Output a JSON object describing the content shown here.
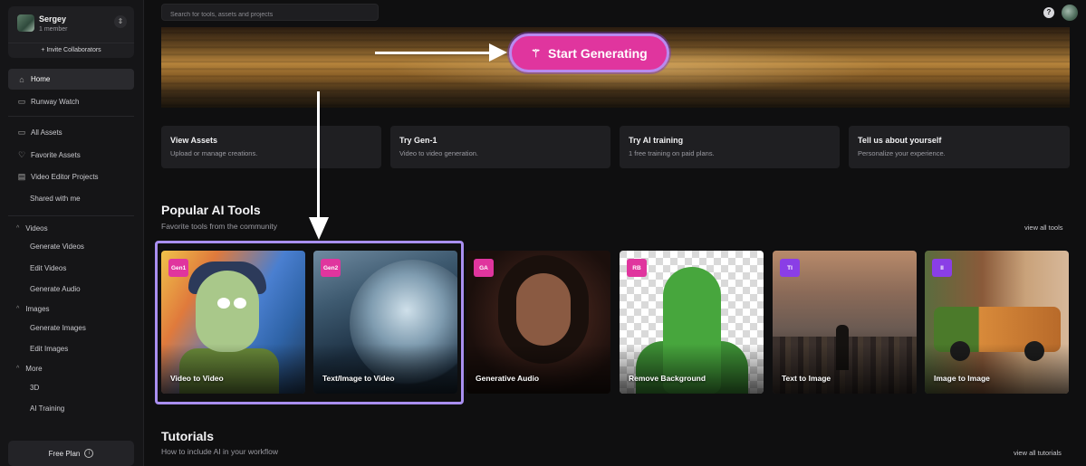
{
  "workspace": {
    "name": "Sergey",
    "members": "1 member",
    "invite_label": "+ Invite Collaborators"
  },
  "search": {
    "placeholder": "Search for tools, assets and projects"
  },
  "topbar": {
    "help_label": "?"
  },
  "sidebar": {
    "primary": [
      {
        "label": "Home",
        "icon": "home-icon",
        "active": true
      },
      {
        "label": "Runway Watch",
        "icon": "tv-icon"
      }
    ],
    "assets": [
      {
        "label": "All Assets",
        "icon": "monitor-icon"
      },
      {
        "label": "Favorite Assets",
        "icon": "heart-icon"
      },
      {
        "label": "Video Editor Projects",
        "icon": "film-icon"
      },
      {
        "label": "Shared with me"
      }
    ],
    "groups": {
      "videos": {
        "label": "Videos",
        "items": [
          "Generate Videos",
          "Edit Videos",
          "Generate Audio"
        ]
      },
      "images": {
        "label": "Images",
        "items": [
          "Generate Images",
          "Edit Images"
        ]
      },
      "more": {
        "label": "More",
        "items": [
          "3D",
          "AI Training"
        ]
      }
    },
    "plan_label": "Free Plan"
  },
  "hero": {
    "cta_label": "Start Generating"
  },
  "quick_cards": [
    {
      "title": "View Assets",
      "subtitle": "Upload or manage creations."
    },
    {
      "title": "Try Gen-1",
      "subtitle": "Video to video generation."
    },
    {
      "title": "Try AI training",
      "subtitle": "1 free training on paid plans."
    },
    {
      "title": "Tell us about yourself",
      "subtitle": "Personalize your experience."
    }
  ],
  "popular": {
    "title": "Popular AI Tools",
    "subtitle": "Favorite tools from the community",
    "view_all": "view all tools",
    "tools": [
      {
        "badge": "Gen1",
        "label": "Video to Video",
        "badge_color": "#e0359e"
      },
      {
        "badge": "Gen2",
        "label": "Text/Image to Video",
        "badge_color": "#e0359e"
      },
      {
        "badge": "GA",
        "label": "Generative Audio",
        "badge_color": "#e0359e"
      },
      {
        "badge": "RB",
        "label": "Remove Background",
        "badge_color": "#e0359e"
      },
      {
        "badge": "TI",
        "label": "Text to Image",
        "badge_color": "#8a3ee6"
      },
      {
        "badge": "II",
        "label": "Image to Image",
        "badge_color": "#8a3ee6"
      }
    ]
  },
  "tutorials": {
    "title": "Tutorials",
    "subtitle": "How to include AI in your workflow",
    "view_all": "view all tutorials"
  }
}
